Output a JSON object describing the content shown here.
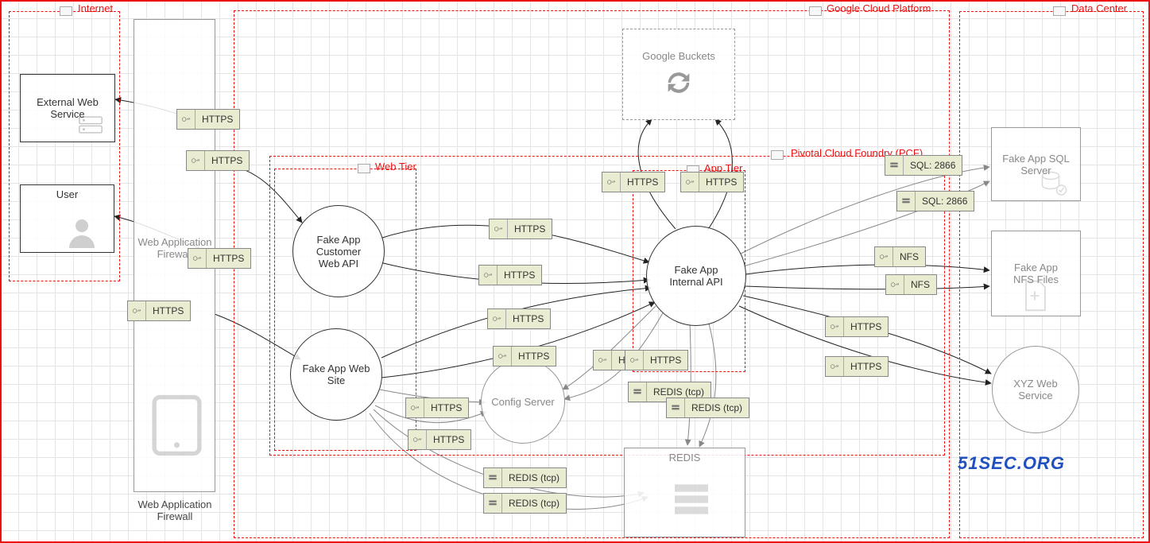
{
  "watermark": "51SEC.ORG",
  "zones": {
    "internet": "Internet",
    "gcp": "Google Cloud Platform",
    "datacenter": "Data Center",
    "pcf": "Pivotal Cloud Foundry (PCF)",
    "webtier": "Web Tier",
    "apptier": "App Tier"
  },
  "nodes": {
    "ext_web_service": "External Web\nService",
    "user": "User",
    "waf_label": "Web Application\nFirewall",
    "waf_inline": "Web Application\nFirewall",
    "google_buckets": "Google Buckets",
    "customer_api": "Fake App\nCustomer\nWeb API",
    "internal_api": "Fake App\nInternal API",
    "fake_site": "Fake App Web\nSite",
    "config_server": "Config Server",
    "redis": "REDIS",
    "sql_server": "Fake App SQL\nServer",
    "nfs_files": "Fake App\nNFS Files",
    "xyz_service": "XYZ Web\nService"
  },
  "protocols": {
    "https": "HTTPS",
    "sql2866": "SQL: 2866",
    "nfs": "NFS",
    "redis_tcp": "REDIS (tcp)"
  },
  "edges": [
    {
      "from": "waf",
      "to": "ext_web_service",
      "proto": "HTTPS"
    },
    {
      "from": "waf",
      "to": "customer_api",
      "proto": "HTTPS"
    },
    {
      "from": "waf",
      "to": "user",
      "proto": "HTTPS"
    },
    {
      "from": "waf",
      "to": "fake_site",
      "proto": "HTTPS"
    },
    {
      "from": "customer_api",
      "to": "internal_api",
      "proto": "HTTPS"
    },
    {
      "from": "customer_api",
      "to": "internal_api",
      "proto": "HTTPS"
    },
    {
      "from": "fake_site",
      "to": "internal_api",
      "proto": "HTTPS"
    },
    {
      "from": "fake_site",
      "to": "internal_api",
      "proto": "HTTPS"
    },
    {
      "from": "fake_site",
      "to": "config_server",
      "proto": "HTTPS"
    },
    {
      "from": "fake_site",
      "to": "config_server",
      "proto": "HTTPS"
    },
    {
      "from": "fake_site",
      "to": "redis",
      "proto": "REDIS (tcp)"
    },
    {
      "from": "fake_site",
      "to": "redis",
      "proto": "REDIS (tcp)"
    },
    {
      "from": "internal_api",
      "to": "google_buckets",
      "proto": "HTTPS"
    },
    {
      "from": "internal_api",
      "to": "google_buckets",
      "proto": "HTTPS"
    },
    {
      "from": "internal_api",
      "to": "config_server",
      "proto": "HTTPS"
    },
    {
      "from": "internal_api",
      "to": "config_server",
      "proto": "HTTPS"
    },
    {
      "from": "internal_api",
      "to": "redis",
      "proto": "REDIS (tcp)"
    },
    {
      "from": "internal_api",
      "to": "redis",
      "proto": "REDIS (tcp)"
    },
    {
      "from": "internal_api",
      "to": "sql_server",
      "proto": "SQL: 2866"
    },
    {
      "from": "internal_api",
      "to": "sql_server",
      "proto": "SQL: 2866"
    },
    {
      "from": "internal_api",
      "to": "nfs_files",
      "proto": "NFS"
    },
    {
      "from": "internal_api",
      "to": "nfs_files",
      "proto": "NFS"
    },
    {
      "from": "internal_api",
      "to": "xyz_service",
      "proto": "HTTPS"
    },
    {
      "from": "internal_api",
      "to": "xyz_service",
      "proto": "HTTPS"
    }
  ]
}
